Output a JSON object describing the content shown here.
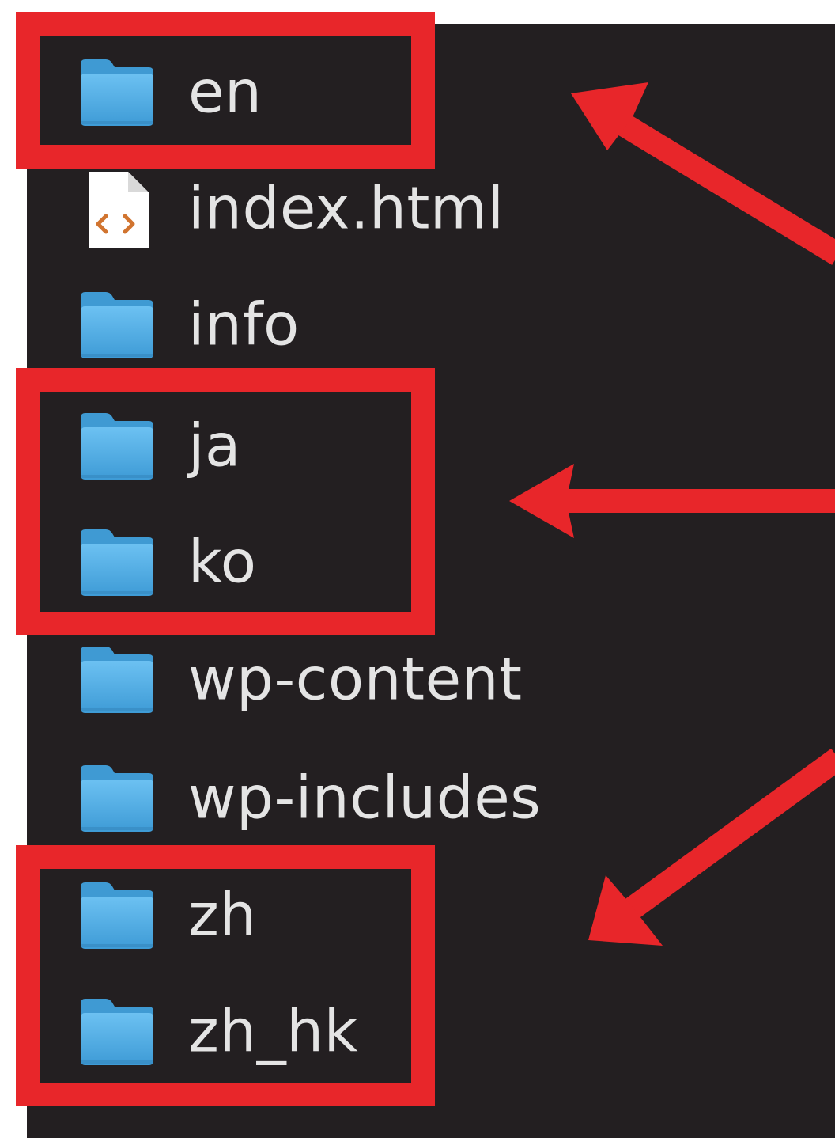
{
  "file_list": {
    "items": [
      {
        "name": "en",
        "type": "folder",
        "icon": "folder-icon"
      },
      {
        "name": "index.html",
        "type": "file",
        "icon": "html-file-icon"
      },
      {
        "name": "info",
        "type": "folder",
        "icon": "folder-icon"
      },
      {
        "name": "ja",
        "type": "folder",
        "icon": "folder-icon"
      },
      {
        "name": "ko",
        "type": "folder",
        "icon": "folder-icon"
      },
      {
        "name": "wp-content",
        "type": "folder",
        "icon": "folder-icon"
      },
      {
        "name": "wp-includes",
        "type": "folder",
        "icon": "folder-icon"
      },
      {
        "name": "zh",
        "type": "folder",
        "icon": "folder-icon"
      },
      {
        "name": "zh_hk",
        "type": "folder",
        "icon": "folder-icon"
      }
    ]
  },
  "annotations": {
    "highlighted_items": [
      "en",
      "ja",
      "ko",
      "zh",
      "zh_hk"
    ],
    "highlight_color": "#e8262a",
    "background_color": "#231f21",
    "folder_color": "#4aa8e3",
    "text_color": "#e4e4e4"
  }
}
